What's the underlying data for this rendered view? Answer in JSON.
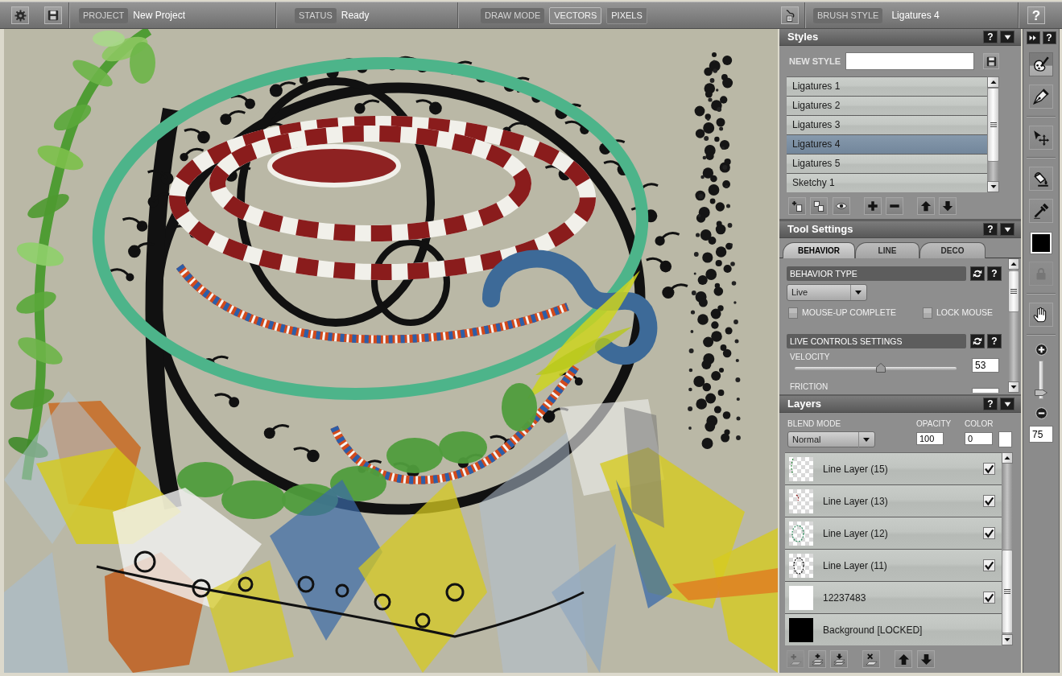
{
  "top_bar": {
    "project_label": "PROJECT",
    "project": "New Project",
    "status_label": "STATUS",
    "status": "Ready",
    "draw_mode_label": "DRAW MODE",
    "draw_modes": [
      {
        "label": "VECTORS",
        "selected": true
      },
      {
        "label": "PIXELS",
        "selected": false
      }
    ],
    "brush_style_label": "BRUSH STYLE",
    "brush_style": "Ligatures 4",
    "help": "?"
  },
  "styles": {
    "title": "Styles",
    "help": "?",
    "new_style_label": "NEW STYLE",
    "items": [
      {
        "name": "Ligatures 1",
        "selected": false
      },
      {
        "name": "Ligatures 2",
        "selected": false
      },
      {
        "name": "Ligatures 3",
        "selected": false
      },
      {
        "name": "Ligatures 4",
        "selected": true
      },
      {
        "name": "Ligatures 5",
        "selected": false
      },
      {
        "name": "Sketchy 1",
        "selected": false
      }
    ]
  },
  "tool_settings": {
    "title": "Tool Settings",
    "help": "?",
    "tabs": [
      {
        "label": "BEHAVIOR",
        "selected": true
      },
      {
        "label": "LINE",
        "selected": false
      },
      {
        "label": "DECO",
        "selected": false
      }
    ],
    "behavior_type": {
      "label": "BEHAVIOR TYPE",
      "help": "?",
      "value": "Live"
    },
    "options": [
      {
        "label": "MOUSE-UP COMPLETE",
        "checked": false
      },
      {
        "label": "LOCK MOUSE",
        "checked": false
      }
    ],
    "live_controls": {
      "label": "LIVE CONTROLS SETTINGS",
      "help": "?",
      "sliders": [
        {
          "label": "VELOCITY",
          "level": 0.53,
          "value": "53"
        },
        {
          "label": "FRICTION"
        }
      ]
    }
  },
  "layers": {
    "title": "Layers",
    "help": "?",
    "blend_mode_label": "BLEND MODE",
    "blend_mode": "Normal",
    "opacity_label": "OPACITY",
    "opacity": "100",
    "color_label": "COLOR",
    "color_value": "0",
    "swatch": {
      "color": "#ffffff"
    },
    "items": [
      {
        "name": "Line Layer (15)",
        "kind": "line",
        "checked": true
      },
      {
        "name": "Line Layer (13)",
        "kind": "line",
        "checked": true
      },
      {
        "name": "Line Layer (12)",
        "kind": "line",
        "checked": true
      },
      {
        "name": "Line Layer (11)",
        "kind": "line",
        "checked": true
      },
      {
        "name": "12237483",
        "kind": "fill",
        "color": "#ffffff",
        "checked": true
      },
      {
        "name": "Background [LOCKED]",
        "kind": "locked",
        "color": "#000000"
      }
    ],
    "tools": [
      {
        "disabled": true
      },
      {
        "disabled": false
      },
      {
        "disabled": false
      },
      {
        "disabled": false
      },
      {
        "disabled": false
      },
      {
        "disabled": false
      }
    ]
  },
  "toolbox": {
    "help": "?",
    "tools": [
      {
        "selected": true
      },
      {
        "selected": false
      },
      {
        "selected": false
      },
      {
        "selected": false
      },
      {
        "selected": false
      },
      {
        "selected": false
      }
    ],
    "color": "#000000",
    "lock": {
      "disabled": true
    },
    "zoom": {
      "level": 0.1,
      "value": "75"
    }
  }
}
